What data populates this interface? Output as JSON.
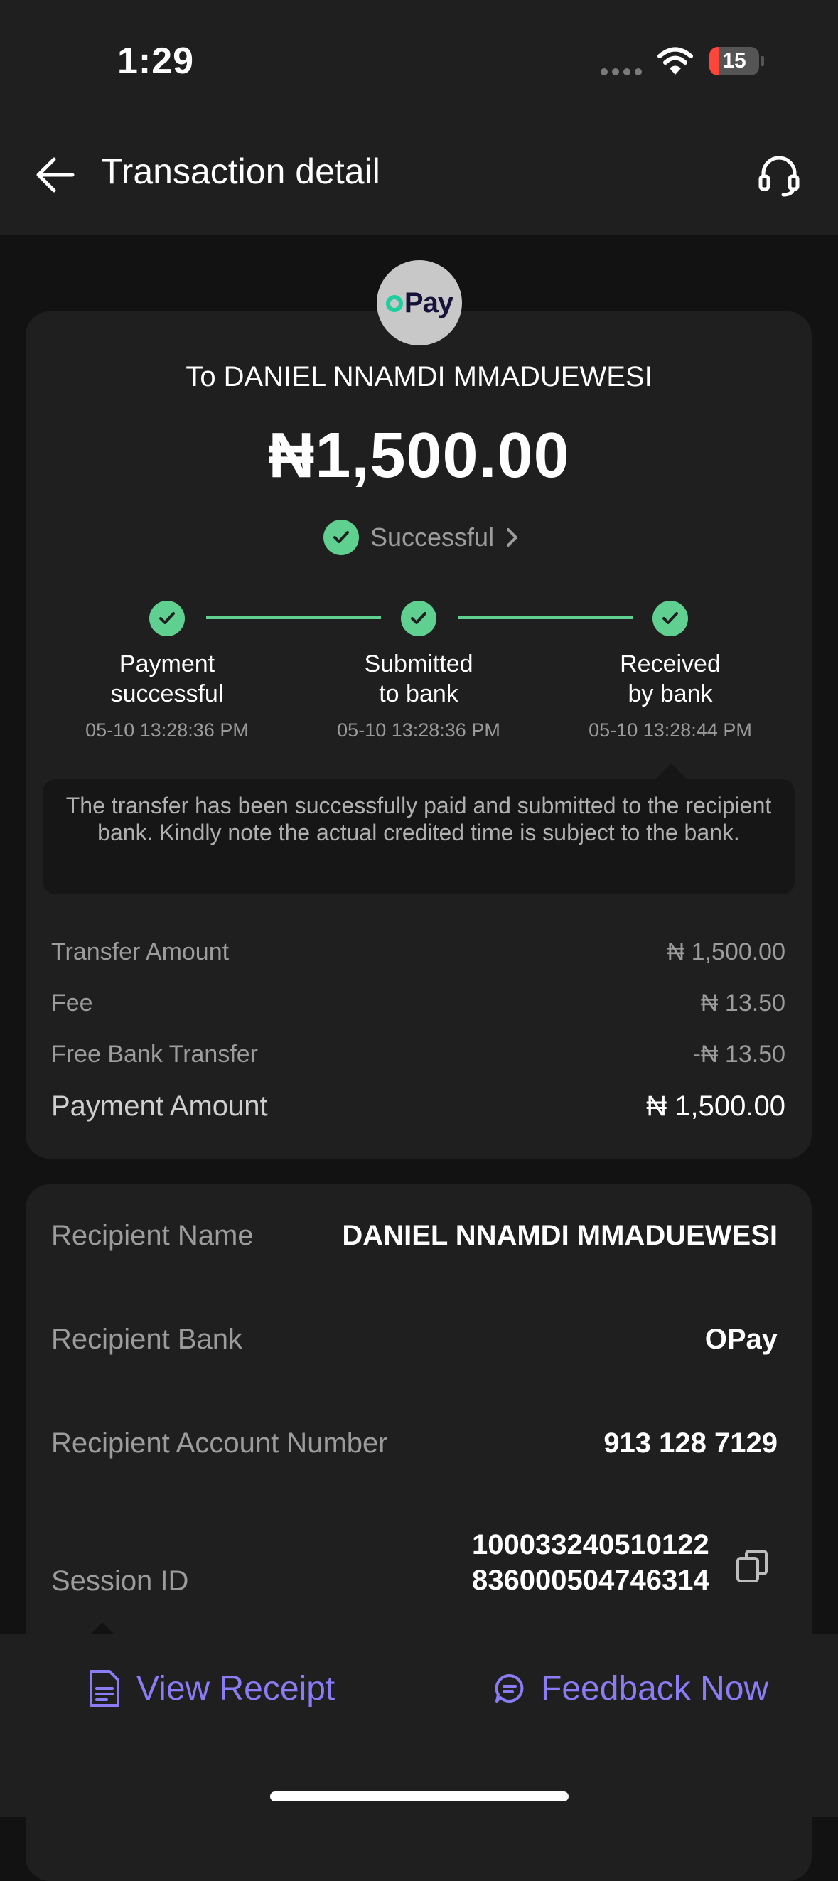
{
  "status_bar": {
    "time": "1:29",
    "battery": "15"
  },
  "header": {
    "title": "Transaction detail"
  },
  "summary": {
    "logo_text": "Pay",
    "recipient_line": "To DANIEL NNAMDI MMADUEWESI",
    "amount": "₦1,500.00",
    "status": "Successful",
    "steps": [
      {
        "line1": "Payment",
        "line2": "successful",
        "time": "05-10 13:28:36 PM"
      },
      {
        "line1": "Submitted",
        "line2": "to bank",
        "time": "05-10 13:28:36 PM"
      },
      {
        "line1": "Received",
        "line2": "by bank",
        "time": "05-10 13:28:44 PM"
      }
    ],
    "note": "The transfer has been successfully paid and submitted to the recipient bank. Kindly note the actual credited time is subject to the bank.",
    "breakdown": [
      {
        "label": "Transfer Amount",
        "value": "₦ 1,500.00"
      },
      {
        "label": "Fee",
        "value": "₦ 13.50"
      },
      {
        "label": "Free Bank Transfer",
        "value": "-₦ 13.50"
      },
      {
        "label": "Payment Amount",
        "value": "₦ 1,500.00"
      }
    ]
  },
  "details": {
    "recipient_name": {
      "label": "Recipient Name",
      "value": "DANIEL NNAMDI MMADUEWESI"
    },
    "recipient_bank": {
      "label": "Recipient Bank",
      "value": "OPay"
    },
    "account_number": {
      "label": "Recipient Account Number",
      "value": "913 128 7129"
    },
    "session_id": {
      "label": "Session ID",
      "value_line1": "100033240510122",
      "value_line2": "836000504746314"
    }
  },
  "actions": {
    "view_receipt": "View Receipt",
    "feedback": "Feedback Now"
  },
  "colors": {
    "accent_green": "#5fd08f",
    "accent_purple": "#8a7cf5",
    "card_bg": "#1f1f1f",
    "page_bg": "#121212"
  }
}
